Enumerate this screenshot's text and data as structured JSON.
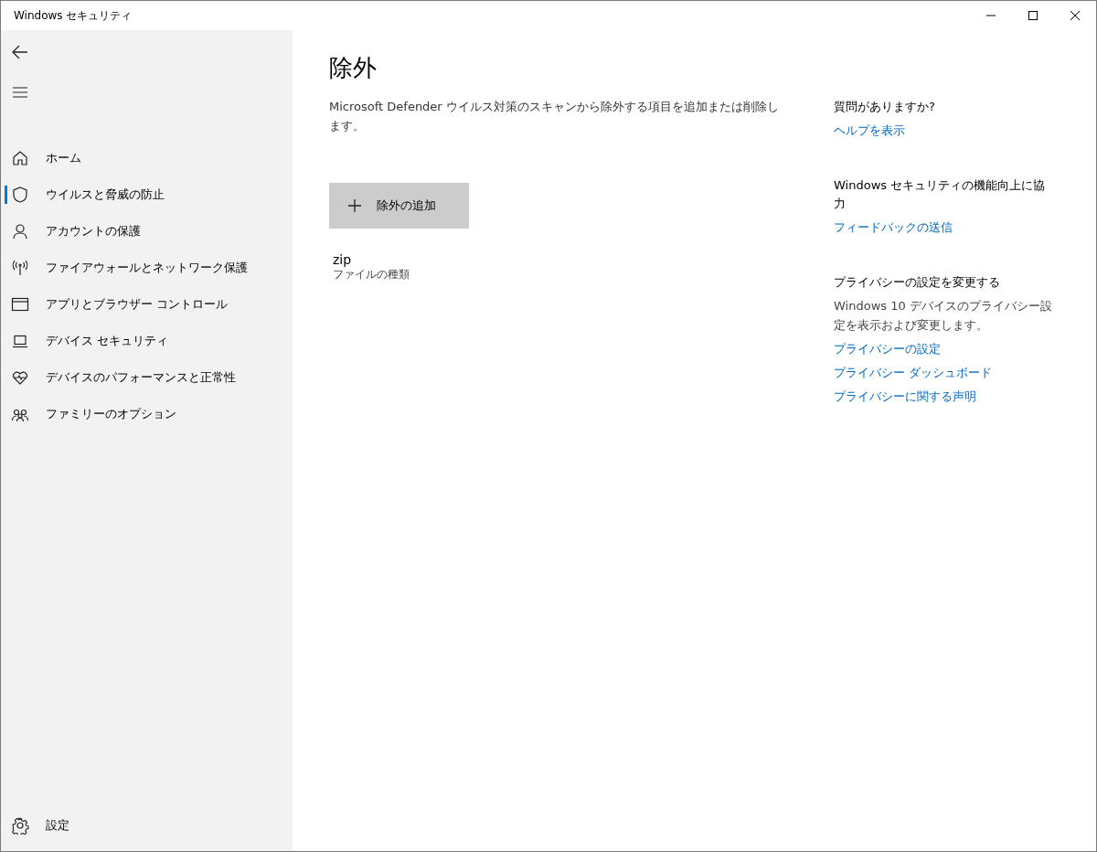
{
  "window": {
    "title": "Windows セキュリティ"
  },
  "sidebar": {
    "items": [
      {
        "label": "ホーム",
        "kind": "home",
        "selected": false
      },
      {
        "label": "ウイルスと脅威の防止",
        "kind": "shield",
        "selected": true
      },
      {
        "label": "アカウントの保護",
        "kind": "person",
        "selected": false
      },
      {
        "label": "ファイアウォールとネットワーク保護",
        "kind": "antenna",
        "selected": false
      },
      {
        "label": "アプリとブラウザー コントロール",
        "kind": "browser",
        "selected": false
      },
      {
        "label": "デバイス セキュリティ",
        "kind": "laptop",
        "selected": false
      },
      {
        "label": "デバイスのパフォーマンスと正常性",
        "kind": "heart",
        "selected": false
      },
      {
        "label": "ファミリーのオプション",
        "kind": "family",
        "selected": false
      }
    ],
    "settings": {
      "label": "設定"
    }
  },
  "main": {
    "title": "除外",
    "description": "Microsoft Defender ウイルス対策のスキャンから除外する項目を追加または削除します。",
    "add_button": "除外の追加",
    "exclusions": [
      {
        "name": "zip",
        "type": "ファイルの種類"
      }
    ]
  },
  "aside": {
    "sections": [
      {
        "heading": "質問がありますか?",
        "links": [
          "ヘルプを表示"
        ]
      },
      {
        "heading": "Windows セキュリティの機能向上に協力",
        "links": [
          "フィードバックの送信"
        ]
      },
      {
        "heading": "プライバシーの設定を変更する",
        "text": "Windows 10 デバイスのプライバシー設定を表示および変更します。",
        "links": [
          "プライバシーの設定",
          "プライバシー ダッシュボード",
          "プライバシーに関する声明"
        ]
      }
    ]
  }
}
